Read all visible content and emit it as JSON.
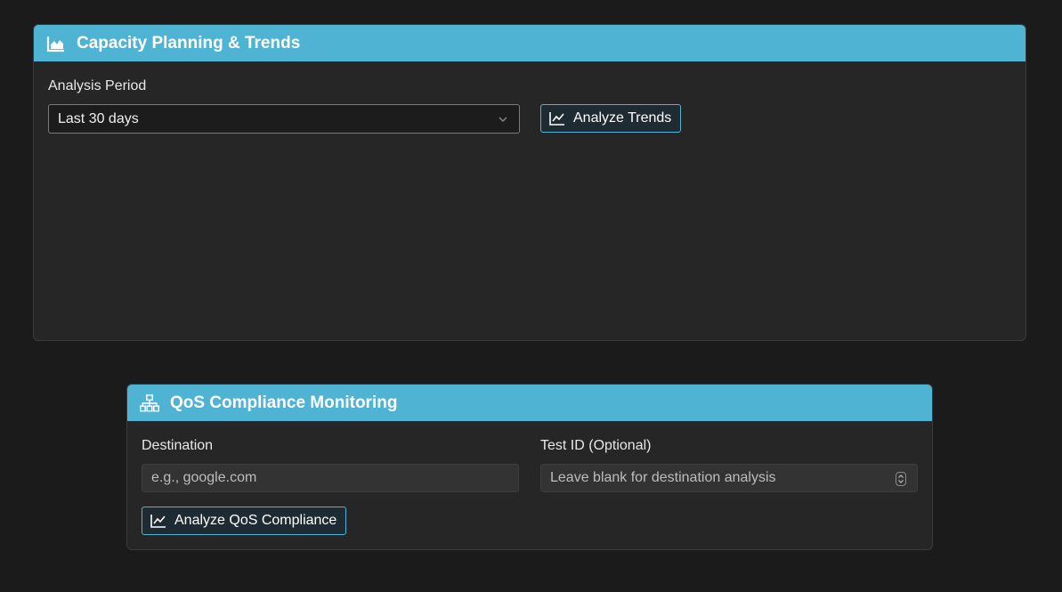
{
  "capacity_card": {
    "title": "Capacity Planning & Trends",
    "icon": "area-chart-icon",
    "period_label": "Analysis Period",
    "period_value": "Last 30 days",
    "analyze_button": "Analyze Trends",
    "analyze_icon": "line-chart-icon"
  },
  "qos_card": {
    "title": "QoS Compliance Monitoring",
    "icon": "network-icon",
    "destination_label": "Destination",
    "destination_placeholder": "e.g., google.com",
    "test_id_label": "Test ID (Optional)",
    "test_id_placeholder": "Leave blank for destination analysis",
    "analyze_button": "Analyze QoS Compliance",
    "analyze_icon": "line-chart-icon"
  },
  "colors": {
    "accent": "#4fb3d3",
    "background": "#1b1b1b",
    "card": "#262626"
  }
}
